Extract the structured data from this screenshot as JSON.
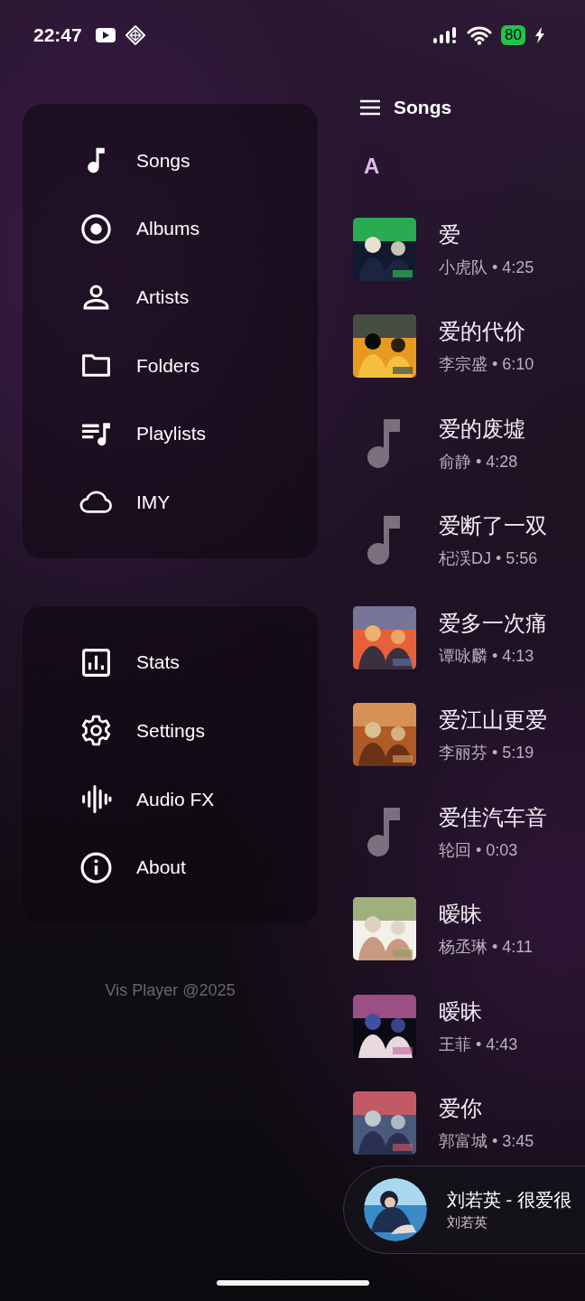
{
  "status_bar": {
    "time": "22:47",
    "battery": "80"
  },
  "drawer": {
    "groups": [
      {
        "items": [
          {
            "label": "Songs"
          },
          {
            "label": "Albums"
          },
          {
            "label": "Artists"
          },
          {
            "label": "Folders"
          },
          {
            "label": "Playlists"
          },
          {
            "label": "IMY"
          }
        ]
      },
      {
        "items": [
          {
            "label": "Stats"
          },
          {
            "label": "Settings"
          },
          {
            "label": "Audio FX"
          },
          {
            "label": "About"
          }
        ]
      }
    ],
    "footer": "Vis Player @2025"
  },
  "header": {
    "title": "Songs"
  },
  "section": {
    "letter": "A"
  },
  "songs": [
    {
      "title": "爱",
      "subtitle": "小虎队 • 4:25",
      "kind": "art"
    },
    {
      "title": "爱的代价",
      "subtitle": "李宗盛 • 6:10",
      "kind": "art"
    },
    {
      "title": "爱的废墟",
      "subtitle": "俞静 • 4:28",
      "kind": "placeholder"
    },
    {
      "title": "爱断了一双",
      "subtitle": "杞渓DJ • 5:56",
      "kind": "placeholder"
    },
    {
      "title": "爱多一次痛",
      "subtitle": "谭咏麟 • 4:13",
      "kind": "art"
    },
    {
      "title": "爱江山更爱",
      "subtitle": "李丽芬 • 5:19",
      "kind": "art"
    },
    {
      "title": "爱佳汽车音",
      "subtitle": "轮回 • 0:03",
      "kind": "placeholder"
    },
    {
      "title": "暧昧",
      "subtitle": "杨丞琳 • 4:11",
      "kind": "art"
    },
    {
      "title": "暧昧",
      "subtitle": "王菲 • 4:43",
      "kind": "art"
    },
    {
      "title": "爱你",
      "subtitle": "郭富城 • 3:45",
      "kind": "art"
    }
  ],
  "now_playing": {
    "title": "刘若英 - 很爱很",
    "artist": "刘若英"
  }
}
